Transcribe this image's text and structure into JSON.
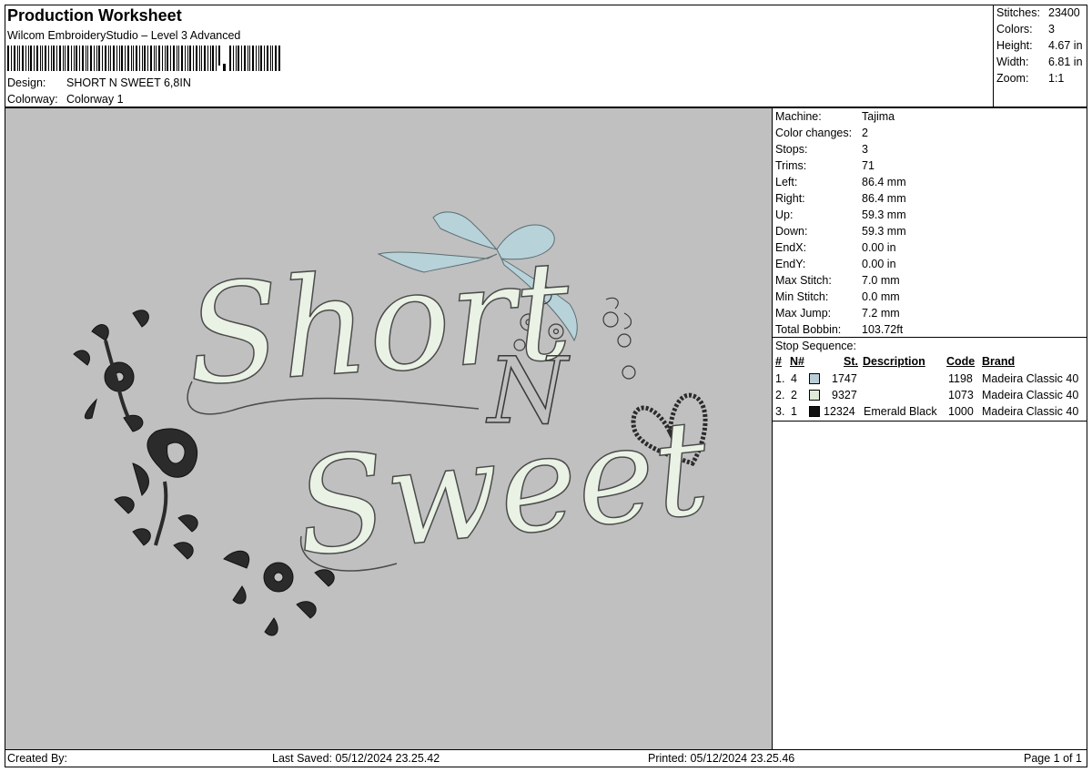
{
  "header": {
    "title": "Production Worksheet",
    "subtitle": "Wilcom EmbroideryStudio – Level 3 Advanced",
    "design_label": "Design:",
    "design_value": "SHORT N SWEET 6,8IN",
    "colorway_label": "Colorway:",
    "colorway_value": "Colorway 1"
  },
  "summary": [
    {
      "label": "Stitches:",
      "value": "23400"
    },
    {
      "label": "Colors:",
      "value": "3"
    },
    {
      "label": "Height:",
      "value": "4.67 in"
    },
    {
      "label": "Width:",
      "value": "6.81 in"
    },
    {
      "label": "Zoom:",
      "value": "1:1"
    }
  ],
  "stats": [
    {
      "label": "Machine:",
      "value": "Tajima"
    },
    {
      "label": "Color changes:",
      "value": "2"
    },
    {
      "label": "Stops:",
      "value": "3"
    },
    {
      "label": "Trims:",
      "value": "71"
    },
    {
      "label": "Left:",
      "value": "86.4 mm"
    },
    {
      "label": "Right:",
      "value": "86.4 mm"
    },
    {
      "label": "Up:",
      "value": "59.3 mm"
    },
    {
      "label": "Down:",
      "value": "59.3 mm"
    },
    {
      "label": "EndX:",
      "value": "0.00 in"
    },
    {
      "label": "EndY:",
      "value": "0.00 in"
    },
    {
      "label": "Max Stitch:",
      "value": "7.0 mm"
    },
    {
      "label": "Min Stitch:",
      "value": "0.0 mm"
    },
    {
      "label": "Max Jump:",
      "value": "7.2 mm"
    },
    {
      "label": "Total Bobbin:",
      "value": "103.72ft"
    }
  ],
  "stop_sequence": {
    "title": "Stop Sequence:",
    "columns": {
      "num": "#",
      "n": "N#",
      "st": "St.",
      "description": "Description",
      "code": "Code",
      "brand": "Brand"
    },
    "rows": [
      {
        "num": "1.",
        "n": "4",
        "color": "#b9cdd6",
        "st": "1747",
        "description": "",
        "code": "1198",
        "brand": "Madeira Classic 40"
      },
      {
        "num": "2.",
        "n": "2",
        "color": "#dfe9d9",
        "st": "9327",
        "description": "",
        "code": "1073",
        "brand": "Madeira Classic 40"
      },
      {
        "num": "3.",
        "n": "1",
        "color": "#111111",
        "st": "12324",
        "description": "Emerald Black",
        "code": "1000",
        "brand": "Madeira Classic 40"
      }
    ]
  },
  "design_preview": {
    "line1": "Short",
    "line2": "N",
    "line3": "Sweet",
    "background": "#c0c0c0",
    "thread_fill": "#e9f2e4",
    "thread_outline": "#4b4b4b",
    "ribbon_color": "#b7d2d9",
    "flower_color": "#2b2b2b"
  },
  "footer": {
    "created_by": "Created By:",
    "last_saved": "Last Saved: 05/12/2024 23.25.42",
    "printed": "Printed: 05/12/2024 23.25.46",
    "page": "Page 1 of 1"
  }
}
